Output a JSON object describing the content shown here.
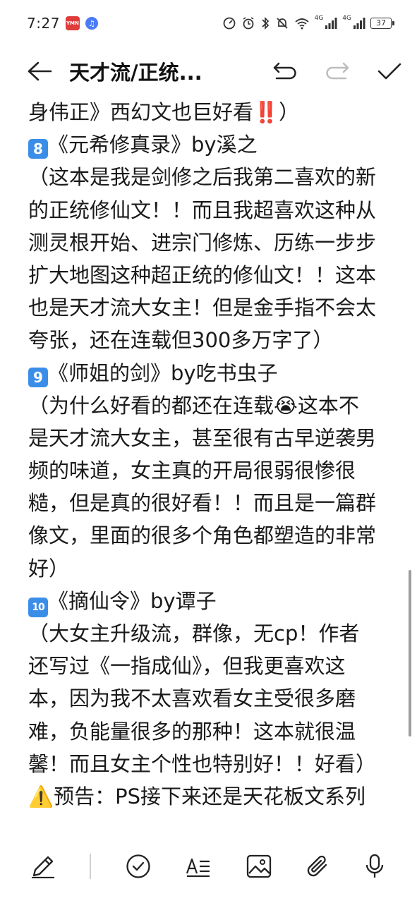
{
  "status_bar": {
    "time": "7:27",
    "app_badge": "YMN",
    "net1": "4G",
    "net2": "4G",
    "battery": "37"
  },
  "toolbar": {
    "title": "天才流/正统..."
  },
  "content": {
    "lines": [
      {
        "text": "身伟正》西幻文也巨好看‼️）"
      },
      {
        "badge": "8",
        "text": "《元希修真录》by溪之"
      },
      {
        "text": "（这本是我是剑修之后我第二喜欢的新"
      },
      {
        "text": "的正统修仙文！！而且我超喜欢这种从"
      },
      {
        "text": "测灵根开始、进宗门修炼、历练一步步"
      },
      {
        "text": "扩大地图这种超正统的修仙文！！这本"
      },
      {
        "text": "也是天才流大女主！但是金手指不会太"
      },
      {
        "text": "夸张，还在连载但300多万字了）"
      },
      {
        "badge": "9",
        "text": "《师姐的剑》by吃书虫子"
      },
      {
        "text": "（为什么好看的都还在连载😭这本不"
      },
      {
        "text": "是天才流大女主，甚至很有古早逆袭男"
      },
      {
        "text": "频的味道，女主真的开局很弱很惨很"
      },
      {
        "text": "糙，但是真的很好看！！而且是一篇群"
      },
      {
        "text": "像文，里面的很多个角色都塑造的非常"
      },
      {
        "text": "好）"
      },
      {
        "badge": "10",
        "text": "《摘仙令》by谭子"
      },
      {
        "text": "（大女主升级流，群像，无cp！作者"
      },
      {
        "text": "还写过《一指成仙》，但我更喜欢这"
      },
      {
        "text": "本，因为我不太喜欢看女主受很多磨"
      },
      {
        "text": "难，负能量很多的那种！这本就很温"
      },
      {
        "text": "馨！而且女主个性也特别好！！好看）"
      },
      {
        "text": "⚠️预告：PS接下来还是天花板文系列"
      }
    ]
  },
  "colors": {
    "badge_blue": "#3b8ee8",
    "text": "#1a1a1a"
  }
}
